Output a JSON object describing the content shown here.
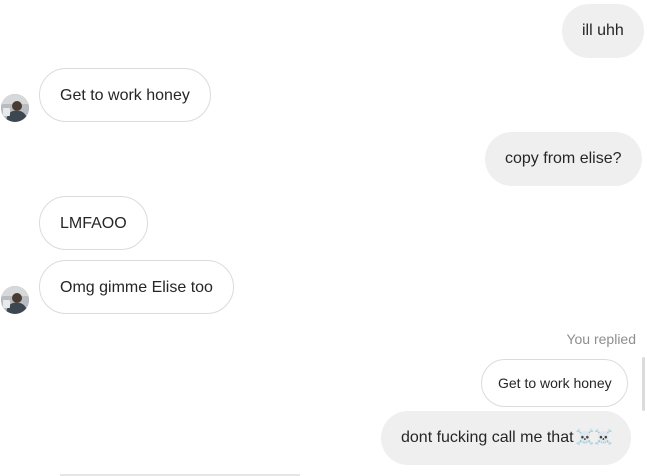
{
  "messages": [
    {
      "id": "m1",
      "direction": "outgoing",
      "text": "ill uhh"
    },
    {
      "id": "m2",
      "direction": "incoming",
      "text": "Get to work honey",
      "avatar": true
    },
    {
      "id": "m3",
      "direction": "outgoing",
      "text": "copy from elise?"
    },
    {
      "id": "m4",
      "direction": "incoming",
      "text": "LMFAOO"
    },
    {
      "id": "m5",
      "direction": "incoming",
      "text": "Omg gimme Elise too",
      "avatar": true
    },
    {
      "id": "m6",
      "direction": "outgoing",
      "text": "dont fucking call me that",
      "emoji": "☠️☠️",
      "reply": {
        "label": "You replied",
        "quoted_text": "Get to work honey"
      }
    }
  ],
  "colors": {
    "outgoing_bubble": "#efefef",
    "incoming_border": "#dbdbdb",
    "text": "#262626",
    "meta_text": "#8e8e8e"
  },
  "icons": {
    "avatar": "user-photo",
    "emoji": "skull-crossbones-icon"
  }
}
